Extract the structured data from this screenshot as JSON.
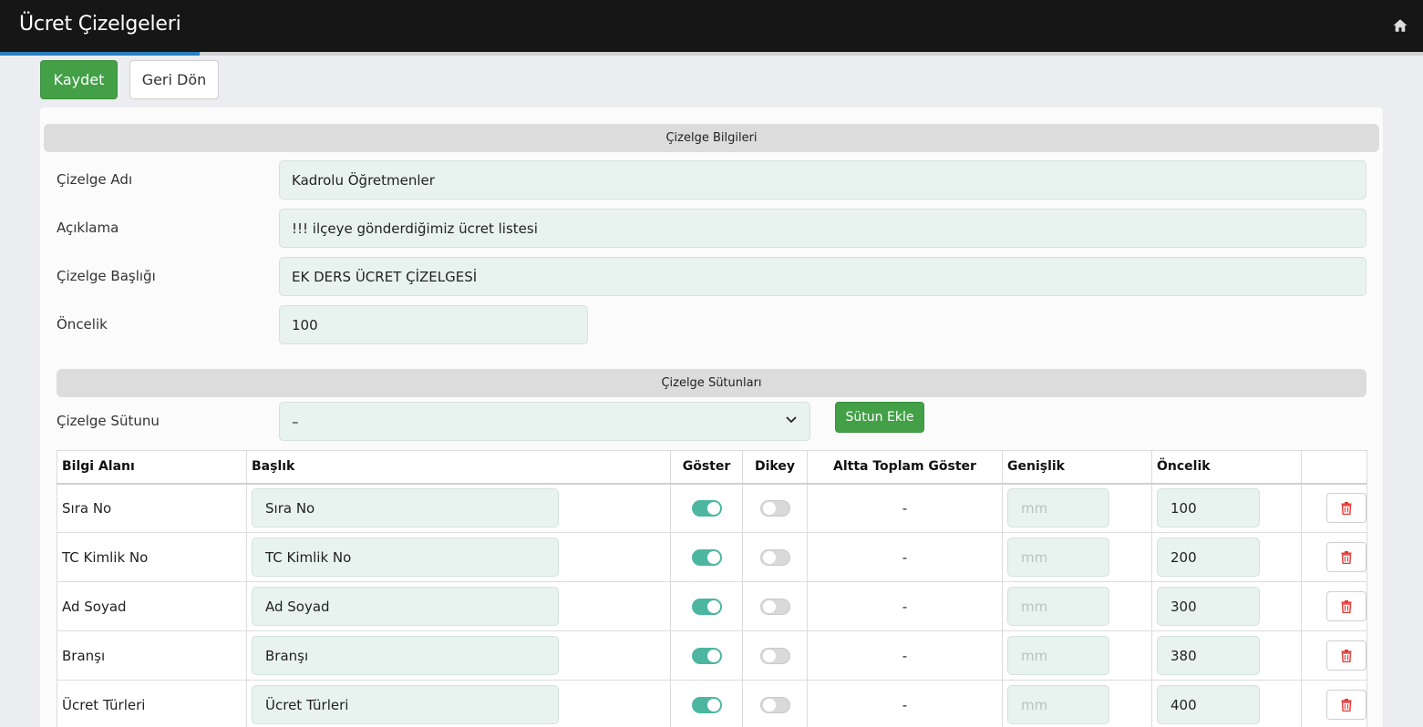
{
  "app": {
    "title": "Ücret Çizelgeleri"
  },
  "toolbar": {
    "save_label": "Kaydet",
    "back_label": "Geri Dön"
  },
  "info_section": {
    "header": "Çizelge Bilgileri",
    "fields": {
      "name_label": "Çizelge Adı",
      "name_value": "Kadrolu Öğretmenler",
      "desc_label": "Açıklama",
      "desc_value": "!!! ilçeye gönderdiğimiz ücret listesi",
      "heading_label": "Çizelge Başlığı",
      "heading_value": "EK DERS ÜCRET ÇİZELGESİ",
      "priority_label": "Öncelik",
      "priority_value": "100"
    }
  },
  "columns_section": {
    "header": "Çizelge Sütunları",
    "column_label": "Çizelge Sütunu",
    "column_selected": "–",
    "add_button": "Sütun Ekle",
    "table": {
      "headers": [
        "Bilgi Alanı",
        "Başlık",
        "Göster",
        "Dikey",
        "Altta Toplam Göster",
        "Genişlik",
        "Öncelik",
        ""
      ],
      "width_placeholder": "mm",
      "rows": [
        {
          "field": "Sıra No",
          "title": "Sıra No",
          "show": true,
          "vertical": false,
          "total": "-",
          "priority": "100"
        },
        {
          "field": "TC Kimlik No",
          "title": "TC Kimlik No",
          "show": true,
          "vertical": false,
          "total": "-",
          "priority": "200"
        },
        {
          "field": "Ad Soyad",
          "title": "Ad Soyad",
          "show": true,
          "vertical": false,
          "total": "-",
          "priority": "300"
        },
        {
          "field": "Branşı",
          "title": "Branşı",
          "show": true,
          "vertical": false,
          "total": "-",
          "priority": "380"
        },
        {
          "field": "Ücret Türleri",
          "title": "Ücret Türleri",
          "show": true,
          "vertical": false,
          "total": "-",
          "priority": "400"
        }
      ]
    }
  },
  "icons": {
    "home": "home-icon",
    "chevron": "chevron-down-icon",
    "delete": "trash-icon"
  },
  "colors": {
    "accent_green": "#43a047",
    "toggle_on": "#4db6a0",
    "delete_red": "#e53935",
    "topbar": "#161616"
  }
}
